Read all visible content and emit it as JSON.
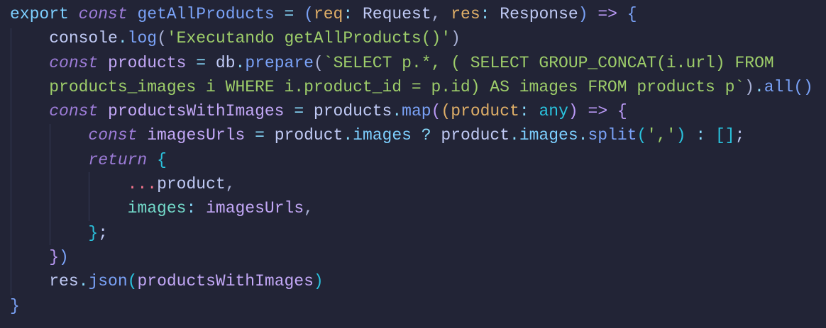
{
  "colors": {
    "background": "#222436"
  },
  "code": {
    "lines": [
      [
        [
          "export",
          "kw"
        ],
        [
          " ",
          "plain"
        ],
        [
          "const",
          "st"
        ],
        [
          " ",
          "plain"
        ],
        [
          "getAllProducts",
          "fn"
        ],
        [
          " ",
          "plain"
        ],
        [
          "=",
          "op"
        ],
        [
          " ",
          "plain"
        ],
        [
          "(",
          "b1"
        ],
        [
          "req",
          "param"
        ],
        [
          ":",
          "op"
        ],
        [
          " ",
          "plain"
        ],
        [
          "Request",
          "type"
        ],
        [
          ",",
          "pun"
        ],
        [
          " ",
          "plain"
        ],
        [
          "res",
          "param"
        ],
        [
          ":",
          "op"
        ],
        [
          " ",
          "plain"
        ],
        [
          "Response",
          "type"
        ],
        [
          ")",
          "b1"
        ],
        [
          " ",
          "plain"
        ],
        [
          "=>",
          "arrow"
        ],
        [
          " ",
          "plain"
        ],
        [
          "{",
          "b1"
        ]
      ],
      [
        [
          "    console",
          "plain"
        ],
        [
          ".",
          "op"
        ],
        [
          "log",
          "fn"
        ],
        [
          "(",
          "pun"
        ],
        [
          "'Executando getAllProducts()'",
          "str"
        ],
        [
          ")",
          "pun"
        ]
      ],
      [
        [
          "    ",
          "plain"
        ],
        [
          "const",
          "st"
        ],
        [
          " ",
          "plain"
        ],
        [
          "products",
          "var"
        ],
        [
          " ",
          "plain"
        ],
        [
          "=",
          "op"
        ],
        [
          " db",
          "plain"
        ],
        [
          ".",
          "op"
        ],
        [
          "prepare",
          "fn"
        ],
        [
          "(",
          "pun"
        ],
        [
          "`SELECT p.*, ( SELECT GROUP_CONCAT(i.url) FROM",
          "str"
        ]
      ],
      [
        [
          "    products_images i WHERE i.product_id = p.id) AS images FROM products p`",
          "str"
        ],
        [
          ")",
          "pun"
        ],
        [
          ".",
          "op"
        ],
        [
          "all",
          "fn"
        ],
        [
          "()",
          "fn"
        ]
      ],
      [
        [
          "    ",
          "plain"
        ],
        [
          "const",
          "st"
        ],
        [
          " ",
          "plain"
        ],
        [
          "productsWithImages",
          "var"
        ],
        [
          " ",
          "plain"
        ],
        [
          "=",
          "op"
        ],
        [
          " products",
          "plain"
        ],
        [
          ".",
          "op"
        ],
        [
          "map",
          "fn"
        ],
        [
          "(",
          "b2"
        ],
        [
          "(",
          "param"
        ],
        [
          "product",
          "param"
        ],
        [
          ":",
          "op"
        ],
        [
          " ",
          "plain"
        ],
        [
          "any",
          "tp"
        ],
        [
          ")",
          "b2"
        ],
        [
          " ",
          "plain"
        ],
        [
          "=>",
          "arrow"
        ],
        [
          " ",
          "plain"
        ],
        [
          "{",
          "b2"
        ]
      ],
      [
        [
          "        ",
          "plain"
        ],
        [
          "const",
          "st"
        ],
        [
          " ",
          "plain"
        ],
        [
          "imagesUrls",
          "var"
        ],
        [
          " ",
          "plain"
        ],
        [
          "=",
          "op"
        ],
        [
          " product",
          "plain"
        ],
        [
          ".",
          "op"
        ],
        [
          "images",
          "prop"
        ],
        [
          " ",
          "plain"
        ],
        [
          "?",
          "op"
        ],
        [
          " product",
          "plain"
        ],
        [
          ".",
          "op"
        ],
        [
          "images",
          "prop"
        ],
        [
          ".",
          "op"
        ],
        [
          "split",
          "fn"
        ],
        [
          "(",
          "b3"
        ],
        [
          "','",
          "str"
        ],
        [
          ")",
          "b3"
        ],
        [
          " ",
          "plain"
        ],
        [
          ":",
          "op"
        ],
        [
          " ",
          "plain"
        ],
        [
          "[]",
          "b3"
        ],
        [
          ";",
          "plain"
        ]
      ],
      [
        [
          "        ",
          "plain"
        ],
        [
          "return",
          "st"
        ],
        [
          " ",
          "plain"
        ],
        [
          "{",
          "b3"
        ]
      ],
      [
        [
          "            ",
          "plain"
        ],
        [
          "...",
          "spread"
        ],
        [
          "product",
          "plain"
        ],
        [
          ",",
          "pun"
        ]
      ],
      [
        [
          "            ",
          "plain"
        ],
        [
          "images",
          "key"
        ],
        [
          ":",
          "op"
        ],
        [
          " ",
          "plain"
        ],
        [
          "imagesUrls",
          "var"
        ],
        [
          ",",
          "pun"
        ]
      ],
      [
        [
          "        ",
          "plain"
        ],
        [
          "}",
          "b3"
        ],
        [
          ";",
          "plain"
        ]
      ],
      [
        [
          "    ",
          "plain"
        ],
        [
          "}",
          "b2"
        ],
        [
          ")",
          "b1"
        ]
      ],
      [
        [
          "    res",
          "plain"
        ],
        [
          ".",
          "op"
        ],
        [
          "json",
          "fn"
        ],
        [
          "(",
          "b3"
        ],
        [
          "productsWithImages",
          "var"
        ],
        [
          ")",
          "b3"
        ]
      ],
      [
        [
          "}",
          "b1"
        ]
      ]
    ]
  }
}
